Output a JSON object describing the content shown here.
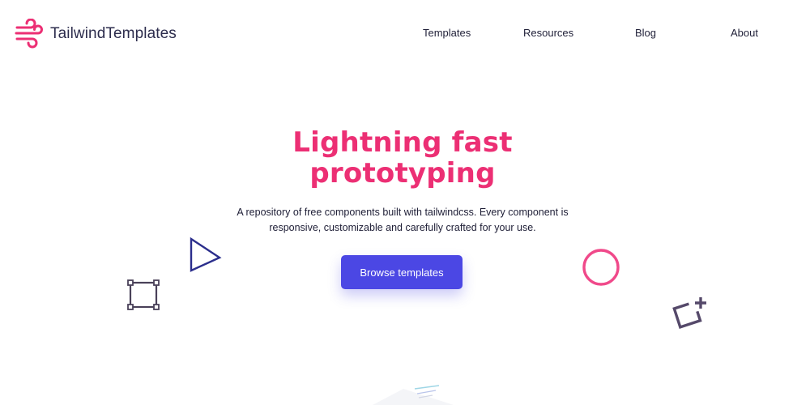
{
  "header": {
    "brand": {
      "name": "TailwindTemplates",
      "logo_icon": "wind-icon",
      "logo_color": "#ec2f74"
    },
    "nav": [
      {
        "id": "templates",
        "label": "Templates"
      },
      {
        "id": "resources",
        "label": "Resources"
      },
      {
        "id": "blog",
        "label": "Blog"
      },
      {
        "id": "about",
        "label": "About"
      }
    ]
  },
  "hero": {
    "title_line1": "Lightning fast",
    "title_line2": "prototyping",
    "subtitle_line1": "A repository of free components built with tailwindcss. Every component is",
    "subtitle_line2": "responsive, customizable and carefully crafted for your use.",
    "cta_label": "Browse templates"
  },
  "decorations": [
    {
      "name": "triangle-outline-icon",
      "color": "#2b2e8c"
    },
    {
      "name": "selection-square-icon",
      "color": "#4a4159"
    },
    {
      "name": "circle-outline-icon",
      "color": "#f0498a"
    },
    {
      "name": "square-plus-icon",
      "color": "#55496a"
    }
  ],
  "colors": {
    "accent": "#ec2f74",
    "primary_button": "#4b47e4",
    "text": "#1e1e36",
    "background": "#ffffff"
  }
}
